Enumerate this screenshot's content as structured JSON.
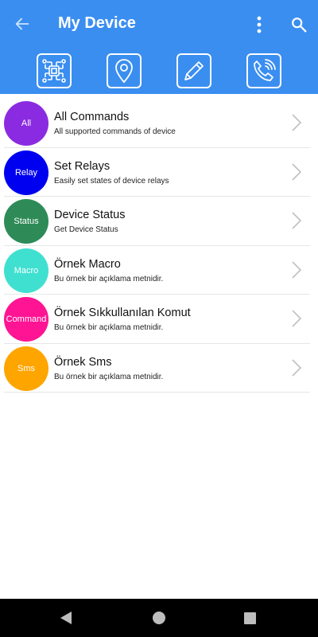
{
  "header": {
    "title": "My Device",
    "back_icon": "arrow-back-icon",
    "more_icon": "more-vert-icon",
    "search_icon": "search-icon",
    "color": "#3a8ef0"
  },
  "toolbar": {
    "buttons": [
      {
        "icon": "circuit-chip-icon"
      },
      {
        "icon": "location-pin-icon"
      },
      {
        "icon": "pencil-icon"
      },
      {
        "icon": "phone-call-icon"
      }
    ]
  },
  "commands": [
    {
      "badge": "All",
      "name": "All Commands",
      "description": "All supported commands of device",
      "color": "#8a2be2"
    },
    {
      "badge": "Relay",
      "name": "Set Relays",
      "description": "Easily set states of device relays",
      "color": "#0000f0"
    },
    {
      "badge": "Status",
      "name": "Device Status",
      "description": "Get Device Status",
      "color": "#2e8b57"
    },
    {
      "badge": "Macro",
      "name": "Örnek Macro",
      "description": "Bu örnek bir açıklama metnidir.",
      "color": "#40e0d0"
    },
    {
      "badge": "Command",
      "name": "Örnek Sıkkullanılan Komut",
      "description": "Bu örnek bir açıklama metnidir.",
      "color": "#ff1493"
    },
    {
      "badge": "Sms",
      "name": "Örnek Sms",
      "description": "Bu örnek bir açıklama metnidir.",
      "color": "#ffa500"
    }
  ],
  "system_nav": {
    "back_icon": "nav-back-icon",
    "home_icon": "nav-home-icon",
    "recents_icon": "nav-recents-icon"
  }
}
